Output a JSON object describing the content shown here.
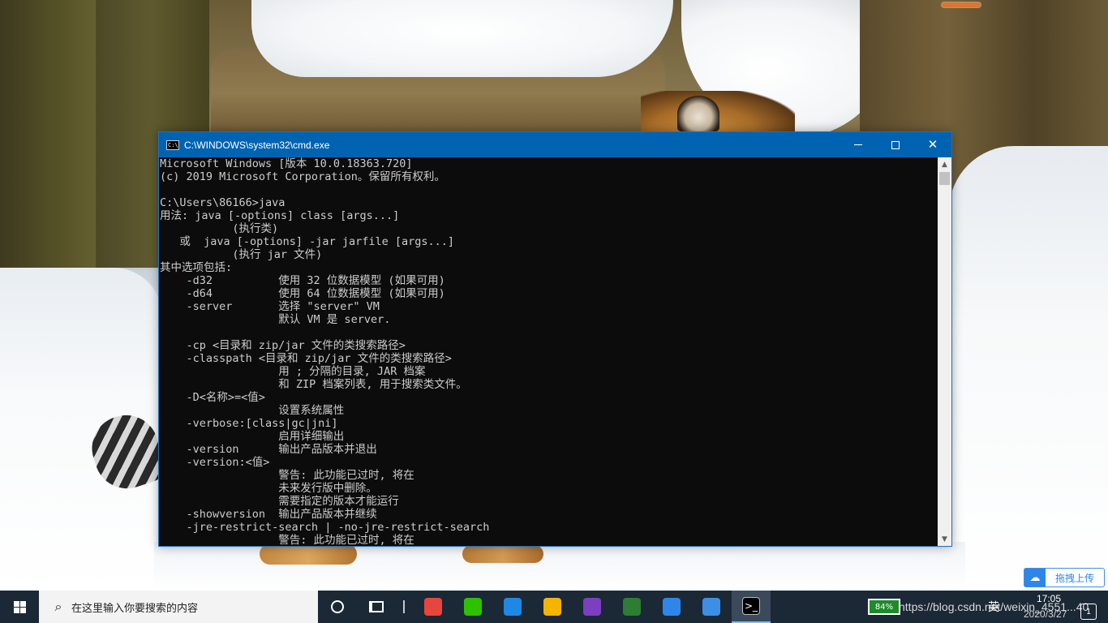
{
  "window": {
    "title": "C:\\WINDOWS\\system32\\cmd.exe",
    "icon_label": "C:\\",
    "minimize_symbol": "",
    "close_symbol": "✕"
  },
  "console_lines": [
    "Microsoft Windows [版本 10.0.18363.720]",
    "(c) 2019 Microsoft Corporation。保留所有权利。",
    "",
    "C:\\Users\\86166>java",
    "用法: java [-options] class [args...]",
    "           (执行类)",
    "   或  java [-options] -jar jarfile [args...]",
    "           (执行 jar 文件)",
    "其中选项包括:",
    "    -d32          使用 32 位数据模型 (如果可用)",
    "    -d64          使用 64 位数据模型 (如果可用)",
    "    -server       选择 \"server\" VM",
    "                  默认 VM 是 server.",
    "",
    "    -cp <目录和 zip/jar 文件的类搜索路径>",
    "    -classpath <目录和 zip/jar 文件的类搜索路径>",
    "                  用 ; 分隔的目录, JAR 档案",
    "                  和 ZIP 档案列表, 用于搜索类文件。",
    "    -D<名称>=<值>",
    "                  设置系统属性",
    "    -verbose:[class|gc|jni]",
    "                  启用详细输出",
    "    -version      输出产品版本并退出",
    "    -version:<值>",
    "                  警告: 此功能已过时, 将在",
    "                  未来发行版中删除。",
    "                  需要指定的版本才能运行",
    "    -showversion  输出产品版本并继续",
    "    -jre-restrict-search | -no-jre-restrict-search",
    "                  警告: 此功能已过时, 将在"
  ],
  "upload": {
    "label": "拖拽上传",
    "icon": "cloud-icon"
  },
  "taskbar": {
    "search_placeholder": "在这里输入你要搜索的内容",
    "apps": [
      {
        "name": "chrome",
        "color": "#e8453c"
      },
      {
        "name": "wechat",
        "color": "#2dc100"
      },
      {
        "name": "app-store",
        "color": "#1e88e5"
      },
      {
        "name": "file-explorer",
        "color": "#f5b400"
      },
      {
        "name": "visual-studio",
        "color": "#7b3fbf"
      },
      {
        "name": "editor",
        "color": "#2e7d32"
      },
      {
        "name": "baidu-netdisk",
        "color": "#2f86e9"
      },
      {
        "name": "remote-app",
        "color": "#3d8fe6"
      },
      {
        "name": "cmd",
        "color": "#000000"
      }
    ]
  },
  "tray": {
    "battery": "84%",
    "watermark": "https://blog.csdn.net/weixin_4551...40",
    "ime": "英",
    "time": "17:05",
    "date": "2020/3/27",
    "notification_count": "1"
  }
}
